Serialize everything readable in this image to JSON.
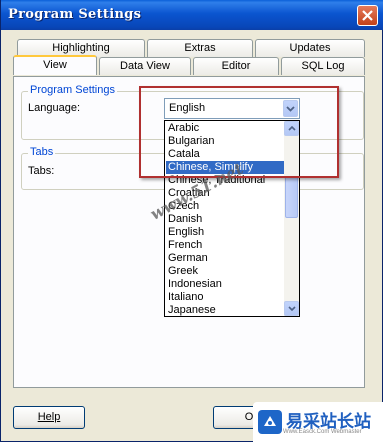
{
  "window": {
    "title": "Program Settings"
  },
  "tabs": {
    "back_row": [
      "Highlighting",
      "Extras",
      "Updates"
    ],
    "front_row": [
      "View",
      "Data View",
      "Editor",
      "SQL Log"
    ],
    "active": "View"
  },
  "program_settings": {
    "group_label": "Program Settings",
    "language_label": "Language:",
    "language_value": "English",
    "language_options": [
      "Arabic",
      "Bulgarian",
      "Catala",
      "Chinese, Simplify",
      "Chinese, Traditional",
      "Croatian",
      "Czech",
      "Danish",
      "English",
      "French",
      "German",
      "Greek",
      "Indonesian",
      "Italiano",
      "Japanese"
    ],
    "highlighted_option": "Chinese, Simplify"
  },
  "tabs_group": {
    "group_label": "Tabs",
    "tabs_label": "Tabs:"
  },
  "buttons": {
    "help": "Help",
    "ok": "O"
  },
  "watermark": "www.51.net",
  "logo": {
    "text": "易采站长站",
    "sub": "Www.Easck.Com  Webmaster"
  },
  "colors": {
    "title_bar": "#0A55D0",
    "selection": "#316AC5",
    "highlight_box": "#B03030"
  }
}
